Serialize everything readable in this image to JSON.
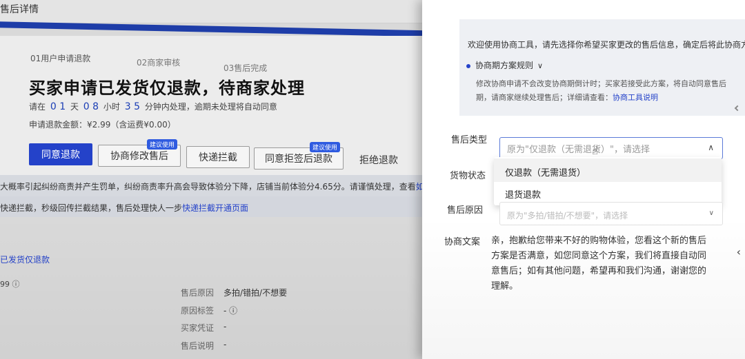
{
  "page": {
    "title": "售后详情",
    "steps": [
      "01用户申请退款",
      "02商家审核",
      "03售后完成"
    ],
    "headline": "买家申请已发货仅退款，待商家处理",
    "countdown": {
      "prefix": "请在",
      "days": "0 1",
      "days_unit": "天",
      "hours": "0 8",
      "hours_unit": "小时",
      "minutes": "3 5",
      "suffix": "分钟内处理，逾期未处理将自动同意"
    },
    "refund_amount": "申请退款金额：¥2.99（含运费¥0.00）",
    "buttons": {
      "agree": "同意退款",
      "negotiate": "协商修改售后",
      "negotiate_tag": "建议使用",
      "intercept": "快递拦截",
      "agree_reject": "同意拒签后退款",
      "agree_reject_tag": "建议使用",
      "reject": "拒绝退款"
    },
    "warning": {
      "line1": "大概率引起纠纷商责并产生罚单，纠纷商责率升高会导致体验分下降，店铺当前体验分4.65分。请谨慎处理，查看",
      "line1_link": "如何",
      "line2": "快递拦截，秒级回传拦截结果，售后处理快人一步",
      "line2_link": "快递拦截开通页面"
    },
    "section_link": "已发货仅退款",
    "amount_short": "99",
    "info_icon": "ⓘ",
    "details": [
      {
        "label": "售后原因",
        "value": "多拍/错拍/不想要"
      },
      {
        "label": "原因标签",
        "value": "- ⓘ"
      },
      {
        "label": "买家凭证",
        "value": "-"
      },
      {
        "label": "售后说明",
        "value": "-"
      }
    ]
  },
  "drawer": {
    "notice_line": "欢迎使用协商工具，请先选择你希望买家更改的售后信息，确定后将此协商方",
    "rule_title": "协商期方案规则",
    "rule_chevron": "∨",
    "rule_text_1": "修改协商申请不会改变协商期倒计时；买家若接受此方案，将自动同意售后",
    "rule_text_2_prefix": "期，请商家继续处理售后；详细请查看：",
    "rule_text_2_link": "协商工具说明",
    "fields": {
      "type_label": "售后类型",
      "type_placeholder": "原为\"仅退款（无需退货）\"，请选择",
      "type_arrow": "∧",
      "options": [
        "仅退款（无需退货）",
        "退货退款"
      ],
      "goods_label": "货物状态",
      "reason_label": "售后原因",
      "reason_placeholder": "原为\"多拍/错拍/不想要\"，请选择",
      "reason_arrow": "∨",
      "text_label": "协商文案",
      "text_value": "亲，抱歉给您带来不好的购物体验，您看这个新的售后方案是否满意，如您同意这个方案，我们将直接自动同意售后；如有其他问题，希望再和我们沟通，谢谢您的理解。"
    },
    "side_arrow": "‹"
  }
}
